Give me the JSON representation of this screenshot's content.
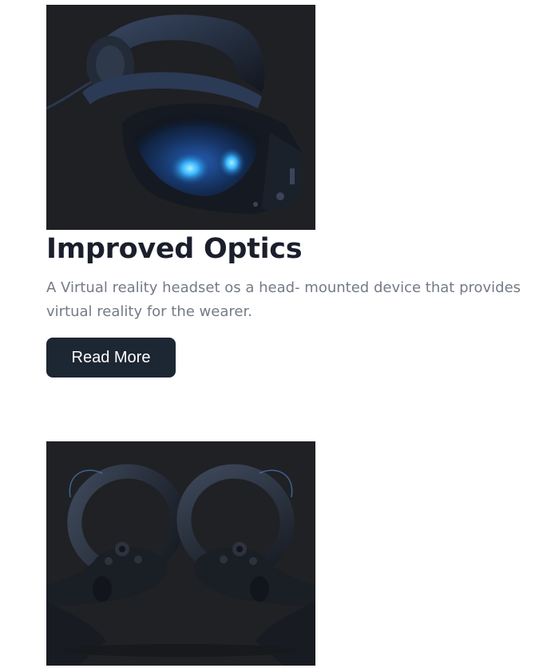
{
  "cards": [
    {
      "image_icon": "vr-headset-image",
      "title": "Improved Optics",
      "description": "A Virtual reality headset os a head- mounted device that provides virtual reality for the wearer.",
      "button_label": "Read More"
    },
    {
      "image_icon": "vr-controllers-image",
      "title": ""
    }
  ],
  "colors": {
    "title": "#1b1f2c",
    "description": "#747b86",
    "button_bg": "#1d2633",
    "button_text": "#ffffff",
    "image_bg": "#1f2023"
  }
}
